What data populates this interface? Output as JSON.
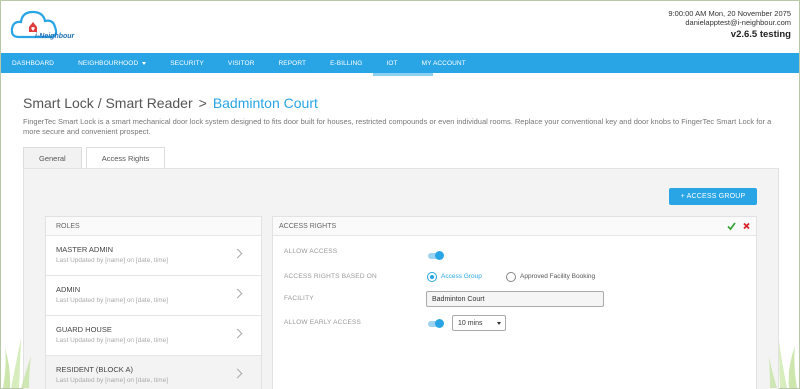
{
  "app": {
    "brand_name": "i-Neighbour",
    "datetime": "9:00:00 AM Mon, 20 November 2075",
    "user_email": "danielapptest@i-neighbour.com",
    "version": "v2.6.5 testing"
  },
  "nav": {
    "items": [
      {
        "label": "DASHBOARD"
      },
      {
        "label": "NEIGHBOURHOOD"
      },
      {
        "label": "SECURITY"
      },
      {
        "label": "VISITOR"
      },
      {
        "label": "REPORT"
      },
      {
        "label": "E-BILLING"
      },
      {
        "label": "IOT"
      },
      {
        "label": "MY ACCOUNT"
      }
    ]
  },
  "page": {
    "title": "Smart Lock / Smart Reader",
    "separator": ">",
    "subtitle": "Badminton Court",
    "description": "FingerTec Smart Lock is a smart mechanical door lock system designed to fits door built for houses, restricted compounds or even individual rooms. Replace your conventional key and door knobs to FingerTec Smart Lock for a more secure and convenient prospect."
  },
  "tabs": [
    {
      "label": "General",
      "active": false
    },
    {
      "label": "Access Rights",
      "active": true
    }
  ],
  "actions": {
    "access_group_label": "+ ACCESS GROUP"
  },
  "roles": {
    "header": "ROLES",
    "items": [
      {
        "name": "MASTER ADMIN",
        "meta": "Last Updated by [name] on [date, time]"
      },
      {
        "name": "ADMIN",
        "meta": "Last Updated by [name] on [date, time]"
      },
      {
        "name": "GUARD HOUSE",
        "meta": "Last Updated by [name] on [date, time]"
      },
      {
        "name": "RESIDENT (BLOCK A)",
        "meta": "Last Updated by [name] on [date, time]"
      }
    ]
  },
  "access_rights": {
    "header": "ACCESS RIGHTS",
    "allow_access_label": "ALLOW ACCESS",
    "allow_access": true,
    "based_on_label": "ACCESS RIGHTS BASED ON",
    "option_access_group": "Access Group",
    "option_facility_booking": "Approved Facility Booking",
    "selected_option": "Access Group",
    "facility_label": "FACILITY",
    "facility_value": "Badminton Court",
    "early_access_label": "ALLOW EARLY ACCESS",
    "early_access": true,
    "early_access_duration": "10 mins"
  },
  "colors": {
    "accent": "#29a5e6",
    "check": "#3aa53a",
    "close": "#d9232a"
  }
}
